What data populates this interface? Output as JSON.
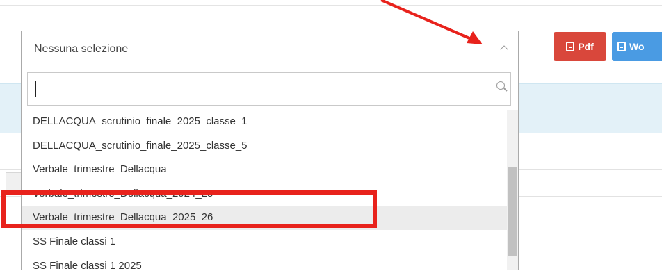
{
  "select": {
    "value": "Nessuna selezione"
  },
  "search": {
    "value": "",
    "placeholder": ""
  },
  "buttons": {
    "pdf": "Pdf",
    "word": "Wo"
  },
  "options": [
    "DELLACQUA_scrutinio_finale_2025_classe_1",
    "DELLACQUA_scrutinio_finale_2025_classe_5",
    "Verbale_trimestre_Dellacqua",
    "Verbale_trimestre_Dellacqua_2024_25",
    "Verbale_trimestre_Dellacqua_2025_26",
    "SS Finale classi 1",
    "SS Finale classi 1 2025"
  ],
  "colors": {
    "pdf": "#d9473b",
    "word": "#4a9be3",
    "annotation": "#e8221c"
  }
}
